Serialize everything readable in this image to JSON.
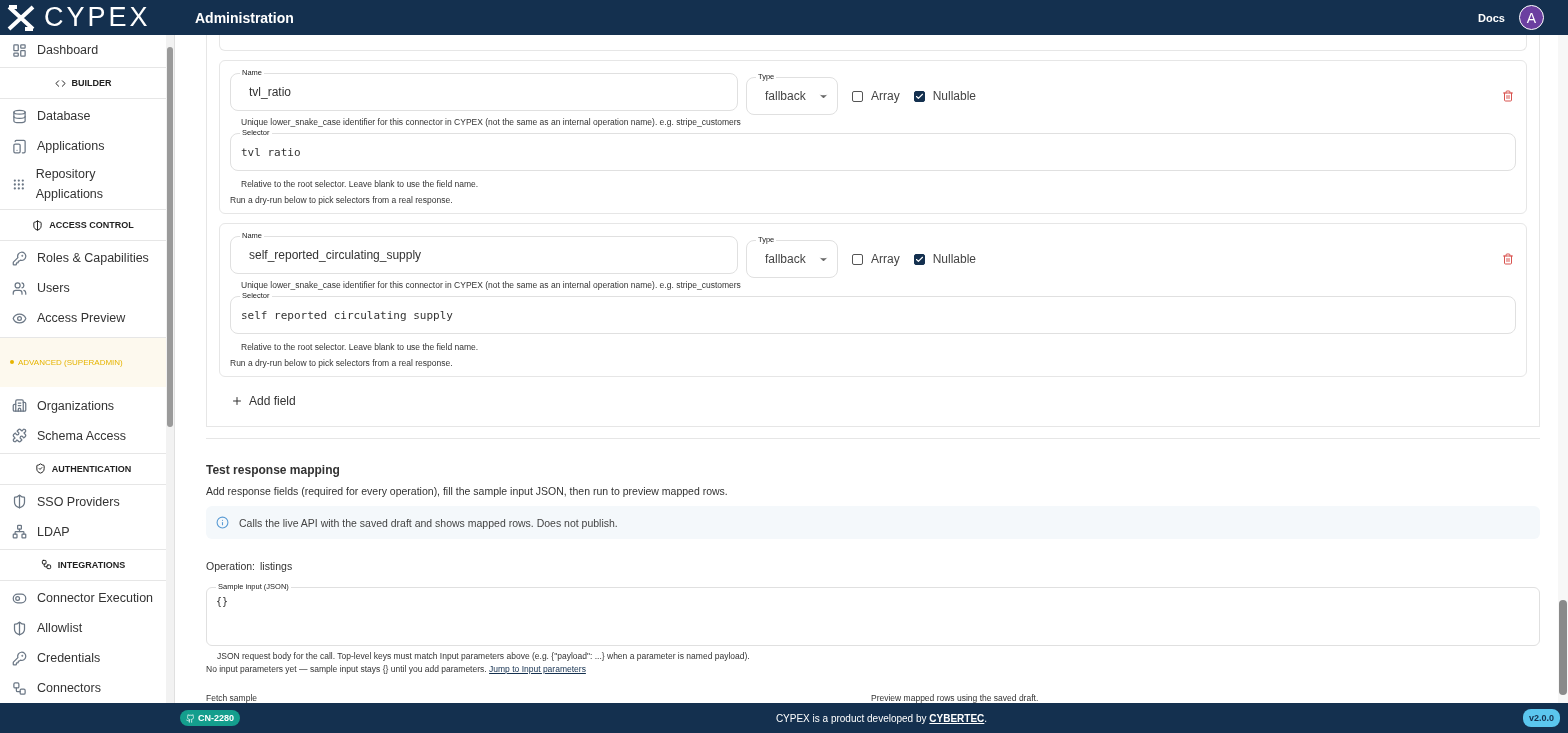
{
  "header": {
    "logo": "CYPEX",
    "title": "Administration",
    "docs": "Docs",
    "avatar": "A"
  },
  "sidebar": {
    "items": [
      {
        "kind": "item",
        "label": "Dashboard"
      },
      {
        "kind": "section",
        "label": "BUILDER"
      },
      {
        "kind": "item",
        "label": "Database"
      },
      {
        "kind": "item",
        "label": "Applications"
      },
      {
        "kind": "item",
        "label": "Repository Applications"
      },
      {
        "kind": "section",
        "label": "ACCESS CONTROL"
      },
      {
        "kind": "item",
        "label": "Roles & Capabilities"
      },
      {
        "kind": "item",
        "label": "Users"
      },
      {
        "kind": "item",
        "label": "Access Preview"
      },
      {
        "kind": "warning",
        "label": "ADVANCED (SUPERADMIN)"
      },
      {
        "kind": "item",
        "label": "Organizations"
      },
      {
        "kind": "item",
        "label": "Schema Access"
      },
      {
        "kind": "section",
        "label": "AUTHENTICATION"
      },
      {
        "kind": "item",
        "label": "SSO Providers"
      },
      {
        "kind": "item",
        "label": "LDAP"
      },
      {
        "kind": "section",
        "label": "INTEGRATIONS"
      },
      {
        "kind": "item",
        "label": "Connector Execution"
      },
      {
        "kind": "item",
        "label": "Allowlist"
      },
      {
        "kind": "item",
        "label": "Credentials"
      },
      {
        "kind": "item",
        "label": "Connectors"
      }
    ]
  },
  "fields": [
    {
      "name_label": "Name",
      "name": "tvl_ratio",
      "type_label": "Type",
      "type": "fallback",
      "array_label": "Array",
      "array": false,
      "nullable_label": "Nullable",
      "nullable": true,
      "name_help": "Unique lower_snake_case identifier for this connector in CYPEX (not the same as an internal operation name). e.g. stripe_customers",
      "selector_label": "Selector",
      "selector": "tvl ratio",
      "selector_help": "Relative to the root selector. Leave blank to use the field name.",
      "dry_run_help": "Run a dry-run below to pick selectors from a real response."
    },
    {
      "name_label": "Name",
      "name": "self_reported_circulating_supply",
      "type_label": "Type",
      "type": "fallback",
      "array_label": "Array",
      "array": false,
      "nullable_label": "Nullable",
      "nullable": true,
      "name_help": "Unique lower_snake_case identifier for this connector in CYPEX (not the same as an internal operation name). e.g. stripe_customers",
      "selector_label": "Selector",
      "selector": "self reported circulating supply",
      "selector_help": "Relative to the root selector. Leave blank to use the field name.",
      "dry_run_help": "Run a dry-run below to pick selectors from a real response."
    }
  ],
  "add_field": "Add field",
  "test": {
    "title": "Test response mapping",
    "description": "Add response fields (required for every operation), fill the sample input JSON, then run to preview mapped rows.",
    "info": "Calls the live API with the saved draft and shows mapped rows. Does not publish.",
    "operation_label": "Operation:",
    "operation": "listings",
    "sample_label": "Sample input (JSON)",
    "sample_value": "{}",
    "sample_help": "JSON request body for the call. Top-level keys must match Input parameters above (e.g. {\"payload\": ...} when a parameter is named payload).",
    "no_params": "No input parameters yet — sample input stays {} until you add parameters.",
    "jump_link": "Jump to Input parameters",
    "fetch_label": "Fetch sample",
    "preview_label": "Preview mapped rows using the saved draft."
  },
  "footer": {
    "branch": "CN-2280",
    "credit": "CYPEX is a product developed by",
    "credit_link": "CYBERTEC",
    "credit_end": ".",
    "version": "v2.0.0"
  }
}
